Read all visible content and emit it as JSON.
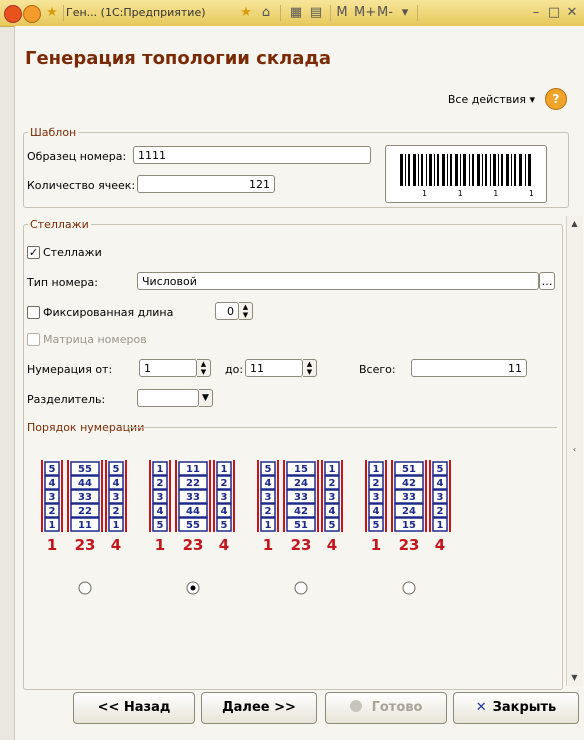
{
  "titlebar": {
    "title": "Ген... (1С:Предприятие)",
    "m_labels": [
      "M",
      "M+",
      "M-"
    ]
  },
  "window": {
    "heading": "Генерация топологии склада",
    "all_actions": "Все действия ▾"
  },
  "template": {
    "legend": "Шаблон",
    "number_label": "Образец номера:",
    "number_value": "1111",
    "cells_label": "Количество ячеек:",
    "cells_value": "121",
    "barcode_digits": "1 1 1 1"
  },
  "racks": {
    "legend": "Стеллажи",
    "racks_checkbox_label": "Стеллажи",
    "racks_checked": true,
    "number_type_label": "Тип номера:",
    "number_type_value": "Числовой",
    "fixed_length_label": "Фиксированная длина",
    "fixed_length_value": "0",
    "matrix_label": "Матрица номеров",
    "numbering_from_label": "Нумерация от:",
    "numbering_from_value": "1",
    "numbering_to_label": "до:",
    "numbering_to_value": "11",
    "total_label": "Всего:",
    "total_value": "11",
    "separator_label": "Разделитель:",
    "separator_value": ""
  },
  "order": {
    "legend": "Порядок нумерации",
    "options": [
      {
        "col1": [
          "5",
          "4",
          "3",
          "2",
          "1"
        ],
        "col2": [
          "55",
          "44",
          "33",
          "22",
          "11"
        ],
        "col3": [
          "5",
          "4",
          "3",
          "2",
          "1"
        ],
        "digits": [
          "1",
          "23",
          "4"
        ],
        "selected": false
      },
      {
        "col1": [
          "1",
          "2",
          "3",
          "4",
          "5"
        ],
        "col2": [
          "11",
          "22",
          "33",
          "44",
          "55"
        ],
        "col3": [
          "1",
          "2",
          "3",
          "4",
          "5"
        ],
        "digits": [
          "1",
          "23",
          "4"
        ],
        "selected": true
      },
      {
        "col1": [
          "5",
          "4",
          "3",
          "2",
          "1"
        ],
        "col2": [
          "15",
          "24",
          "33",
          "42",
          "51"
        ],
        "col3": [
          "1",
          "2",
          "3",
          "4",
          "5"
        ],
        "digits": [
          "1",
          "23",
          "4"
        ],
        "selected": false
      },
      {
        "col1": [
          "1",
          "2",
          "3",
          "4",
          "5"
        ],
        "col2": [
          "51",
          "42",
          "33",
          "24",
          "15"
        ],
        "col3": [
          "5",
          "4",
          "3",
          "2",
          "1"
        ],
        "digits": [
          "1",
          "23",
          "4"
        ],
        "selected": false
      }
    ]
  },
  "buttons": {
    "back": "<< Назад",
    "next": "Далее >>",
    "done": "Готово",
    "close": "Закрыть"
  },
  "colors": {
    "heading": "#7a2a05",
    "diagram_blue": "#1c2a8c",
    "diagram_red": "#c4161c",
    "help": "#f1a42a"
  }
}
